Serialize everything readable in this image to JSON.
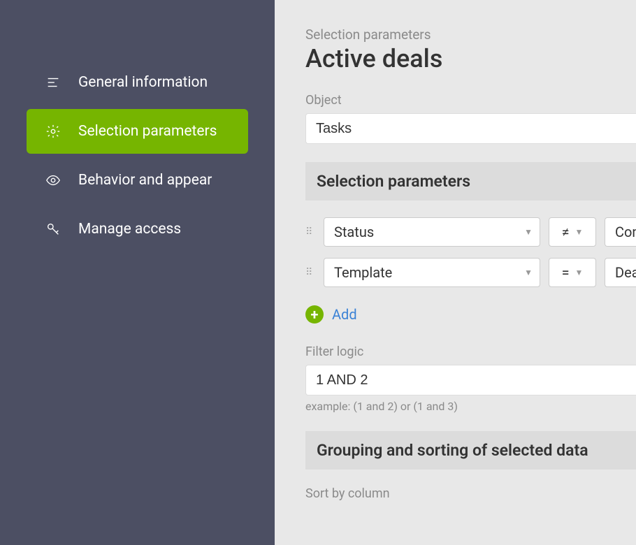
{
  "sidebar": {
    "items": [
      {
        "label": "General information"
      },
      {
        "label": "Selection parameters"
      },
      {
        "label": "Behavior and appear"
      },
      {
        "label": "Manage access"
      }
    ]
  },
  "header": {
    "breadcrumb": "Selection parameters",
    "title": "Active deals"
  },
  "object": {
    "label": "Object",
    "value": "Tasks"
  },
  "section1": {
    "title": "Selection parameters"
  },
  "filters": [
    {
      "field": "Status",
      "op": "≠",
      "value": "Comp"
    },
    {
      "field": "Template",
      "op": "=",
      "value": "Deal"
    }
  ],
  "add_label": "Add",
  "filter_logic": {
    "label": "Filter logic",
    "value": "1 AND 2",
    "hint": "example: (1 and 2) or (1 and 3)"
  },
  "section2": {
    "title": "Grouping and sorting of selected data"
  },
  "sort_label": "Sort by column"
}
